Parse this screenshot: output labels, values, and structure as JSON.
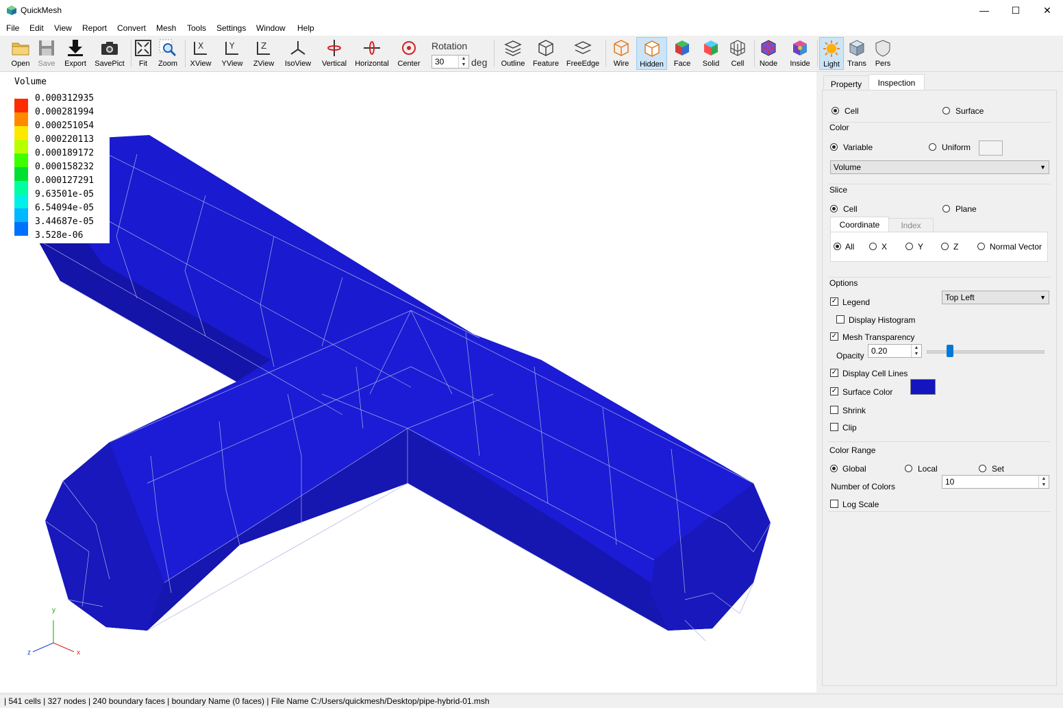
{
  "window": {
    "title": "QuickMesh",
    "minimize": "—",
    "maximize": "☐",
    "close": "✕"
  },
  "menu": [
    "File",
    "Edit",
    "View",
    "Report",
    "Convert",
    "Mesh",
    "Tools",
    "Settings",
    "Window",
    "Help"
  ],
  "toolbar": {
    "open": "Open",
    "save": "Save",
    "export": "Export",
    "savepict": "SavePict",
    "fit": "Fit",
    "zoom": "Zoom",
    "xview": "XView",
    "yview": "YView",
    "zview": "ZView",
    "isoview": "IsoView",
    "vertical": "Vertical",
    "horizontal": "Horizontal",
    "center": "Center",
    "rotation_label": "Rotation",
    "rotation_value": "30",
    "rotation_unit": "deg",
    "outline": "Outline",
    "feature": "Feature",
    "freeedge": "FreeEdge",
    "wire": "Wire",
    "hidden": "Hidden",
    "face": "Face",
    "solid": "Solid",
    "cell": "Cell",
    "node": "Node",
    "inside": "Inside",
    "light": "Light",
    "trans": "Trans",
    "pers": "Pers"
  },
  "legend": {
    "title": "Volume",
    "values": [
      "0.000312935",
      "0.000281994",
      "0.000251054",
      "0.000220113",
      "0.000189172",
      "0.000158232",
      "0.000127291",
      "9.63501e-05",
      "6.54094e-05",
      "3.44687e-05",
      "3.528e-06"
    ],
    "colors": [
      "#ff2a00",
      "#ff8a00",
      "#ffe800",
      "#b8ff00",
      "#3cff00",
      "#00e030",
      "#00ffa0",
      "#00f0e8",
      "#00b8ff",
      "#0070ff",
      "#0030ff"
    ]
  },
  "axes": {
    "y": "y",
    "x": "x",
    "z": "z"
  },
  "panel": {
    "tabs": {
      "property": "Property",
      "inspection": "Inspection"
    },
    "cell": "Cell",
    "surface": "Surface",
    "color_group": "Color",
    "variable": "Variable",
    "uniform": "Uniform",
    "variable_select": "Volume",
    "slice_group": "Slice",
    "slice_cell": "Cell",
    "slice_plane": "Plane",
    "coord_tab": "Coordinate",
    "index_tab": "Index",
    "all": "All",
    "x": "X",
    "y": "Y",
    "z": "Z",
    "normal": "Normal Vector",
    "options_group": "Options",
    "legend": "Legend",
    "legend_pos": "Top Left",
    "histogram": "Display Histogram",
    "transparency": "Mesh Transparency",
    "opacity_label": "Opacity",
    "opacity_value": "0.20",
    "opacity_level": 0.2,
    "cell_lines": "Display Cell Lines",
    "surface_color": "Surface Color",
    "surface_color_hex": "#1515c0",
    "shrink": "Shrink",
    "clip": "Clip",
    "range_group": "Color Range",
    "global": "Global",
    "local": "Local",
    "set": "Set",
    "num_colors_label": "Number of Colors",
    "num_colors": "10",
    "log_scale": "Log Scale"
  },
  "status": "| 541 cells | 327 nodes | 240 boundary faces |  boundary Name  (0 faces) | File Name C:/Users/quickmesh/Desktop/pipe-hybrid-01.msh"
}
